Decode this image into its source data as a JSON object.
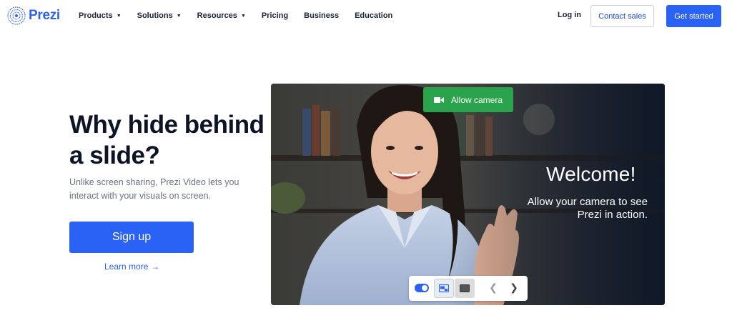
{
  "brand": {
    "name": "Prezi",
    "color": "#2e63f0"
  },
  "nav": {
    "items": [
      {
        "label": "Products",
        "has_caret": true
      },
      {
        "label": "Solutions",
        "has_caret": true
      },
      {
        "label": "Resources",
        "has_caret": true
      },
      {
        "label": "Pricing",
        "has_caret": false
      },
      {
        "label": "Business",
        "has_caret": false
      },
      {
        "label": "Education",
        "has_caret": false
      }
    ],
    "login": "Log in",
    "contact_sales": "Contact sales",
    "get_started": "Get started"
  },
  "hero": {
    "headline": "Why hide behind a slide?",
    "subtext": "Unlike screen sharing, Prezi Video lets you interact with your visuals on screen.",
    "signup": "Sign up",
    "learn_more": "Learn more",
    "learn_more_arrow": "→"
  },
  "video": {
    "allow_camera": "Allow camera",
    "welcome": "Welcome!",
    "welcome_sub": "Allow your camera to see Prezi in action.",
    "accent_green": "#2ba24c"
  },
  "controls": {
    "toggle_on": true,
    "prev_icon": "chevron-left-icon",
    "next_icon": "chevron-right-icon",
    "prev_glyph": "❮",
    "next_glyph": "❯"
  },
  "colors": {
    "primary": "#2a62f5",
    "heading": "#0c1426",
    "muted": "#6b7280"
  }
}
